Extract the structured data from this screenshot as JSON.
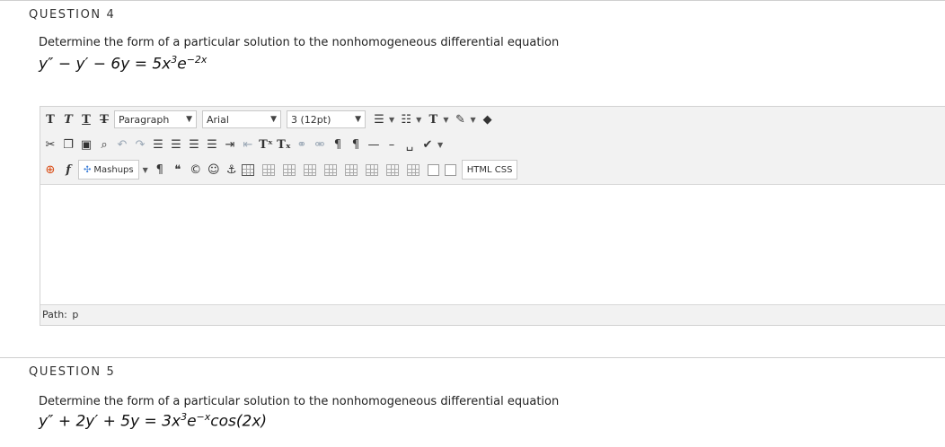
{
  "question4": {
    "heading": "QUESTION 4",
    "prompt": "Determine the form of a particular solution to the nonhomogeneous differential equation",
    "equation_main": "y″ − y′ − 6y = 5x",
    "equation_sup1": "3",
    "equation_mid": "e",
    "equation_sup2": "−2x"
  },
  "editor": {
    "format_select": "Paragraph",
    "font_select": "Arial",
    "size_select": "3 (12pt)",
    "mashups_label": "Mashups",
    "html_css_label": "HTML CSS",
    "path_label": "Path:",
    "path_value": "p",
    "icons": {
      "row1": [
        "bold-icon",
        "italic-icon",
        "underline-icon",
        "strikethrough-icon",
        "bullet-list-icon",
        "numbered-list-icon",
        "text-color-icon",
        "highlight-icon",
        "eraser-icon"
      ],
      "row2": [
        "cut-icon",
        "copy-icon",
        "paste-icon",
        "find-icon",
        "undo-icon",
        "redo-icon",
        "align-left-icon",
        "align-center-icon",
        "align-right-icon",
        "align-justify-icon",
        "indent-icon",
        "outdent-icon",
        "superscript-icon",
        "subscript-icon",
        "link-icon",
        "unlink-icon",
        "ltr-icon",
        "rtl-icon",
        "horizontal-rule-icon",
        "dash-icon",
        "nonbreaking-space-icon",
        "spellcheck-icon"
      ],
      "row3": [
        "add-content-icon",
        "math-formula-icon",
        "mashups-icon",
        "paragraph-mark-icon",
        "blockquote-icon",
        "copyright-icon",
        "emoticon-icon",
        "anchor-icon",
        "table-icons",
        "html-css-icon"
      ]
    }
  },
  "question5": {
    "heading": "QUESTION 5",
    "prompt": "Determine the form of a particular solution to the nonhomogeneous differential equation",
    "equation_main": "y″ + 2y′ + 5y = 3x",
    "equation_sup1": "3",
    "equation_mid": "e",
    "equation_sup2": "−x",
    "equation_tail": "cos(2x)"
  }
}
